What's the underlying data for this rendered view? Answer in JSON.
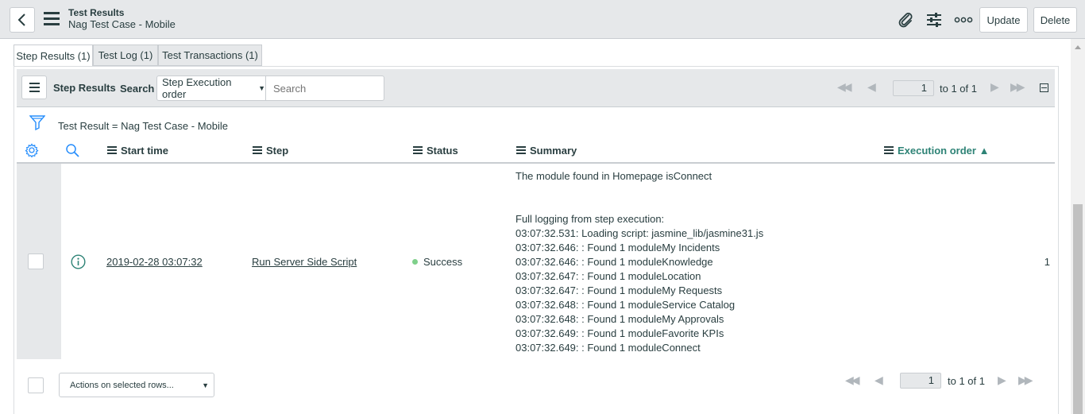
{
  "header": {
    "title": "Test Results",
    "subtitle": "Nag Test Case - Mobile",
    "update_label": "Update",
    "delete_label": "Delete"
  },
  "tabs": [
    {
      "label": "Step Results (1)"
    },
    {
      "label": "Test Log (1)"
    },
    {
      "label": "Test Transactions (1)"
    }
  ],
  "toolbar": {
    "list_title": "Step Results",
    "search_label": "Search",
    "search_field": "Step Execution order",
    "search_placeholder": "Search",
    "page": "1",
    "page_range": "to 1 of 1"
  },
  "filter": {
    "text": "Test Result = Nag Test Case - Mobile"
  },
  "columns": {
    "start_time": "Start time",
    "step": "Step",
    "status": "Status",
    "summary": "Summary",
    "execution_order": "Execution order ▲"
  },
  "row": {
    "start_time": "2019-02-28 03:07:32",
    "step": "Run Server Side Script",
    "status": "Success",
    "status_color": "#7fd08b",
    "execution_order": "1",
    "summary_lines": [
      "The module found in Homepage isConnect",
      "Full logging from step execution:",
      "03:07:32.531: Loading script: jasmine_lib/jasmine31.js",
      "03:07:32.646: : Found 1 moduleMy Incidents",
      "03:07:32.646: : Found 1 moduleKnowledge",
      "03:07:32.647: : Found 1 moduleLocation",
      "03:07:32.647: : Found 1 moduleMy Requests",
      "03:07:32.648: : Found 1 moduleService Catalog",
      "03:07:32.648: : Found 1 moduleMy Approvals",
      "03:07:32.649: : Found 1 moduleFavorite KPIs",
      "03:07:32.649: : Found 1 moduleConnect"
    ]
  },
  "footer": {
    "actions_label": "Actions on selected rows...",
    "page": "1",
    "page_range": "to 1 of 1"
  },
  "colors": {
    "accent": "#278efc",
    "sort_active": "#2e8376",
    "header_bg": "#e6e8ea"
  }
}
